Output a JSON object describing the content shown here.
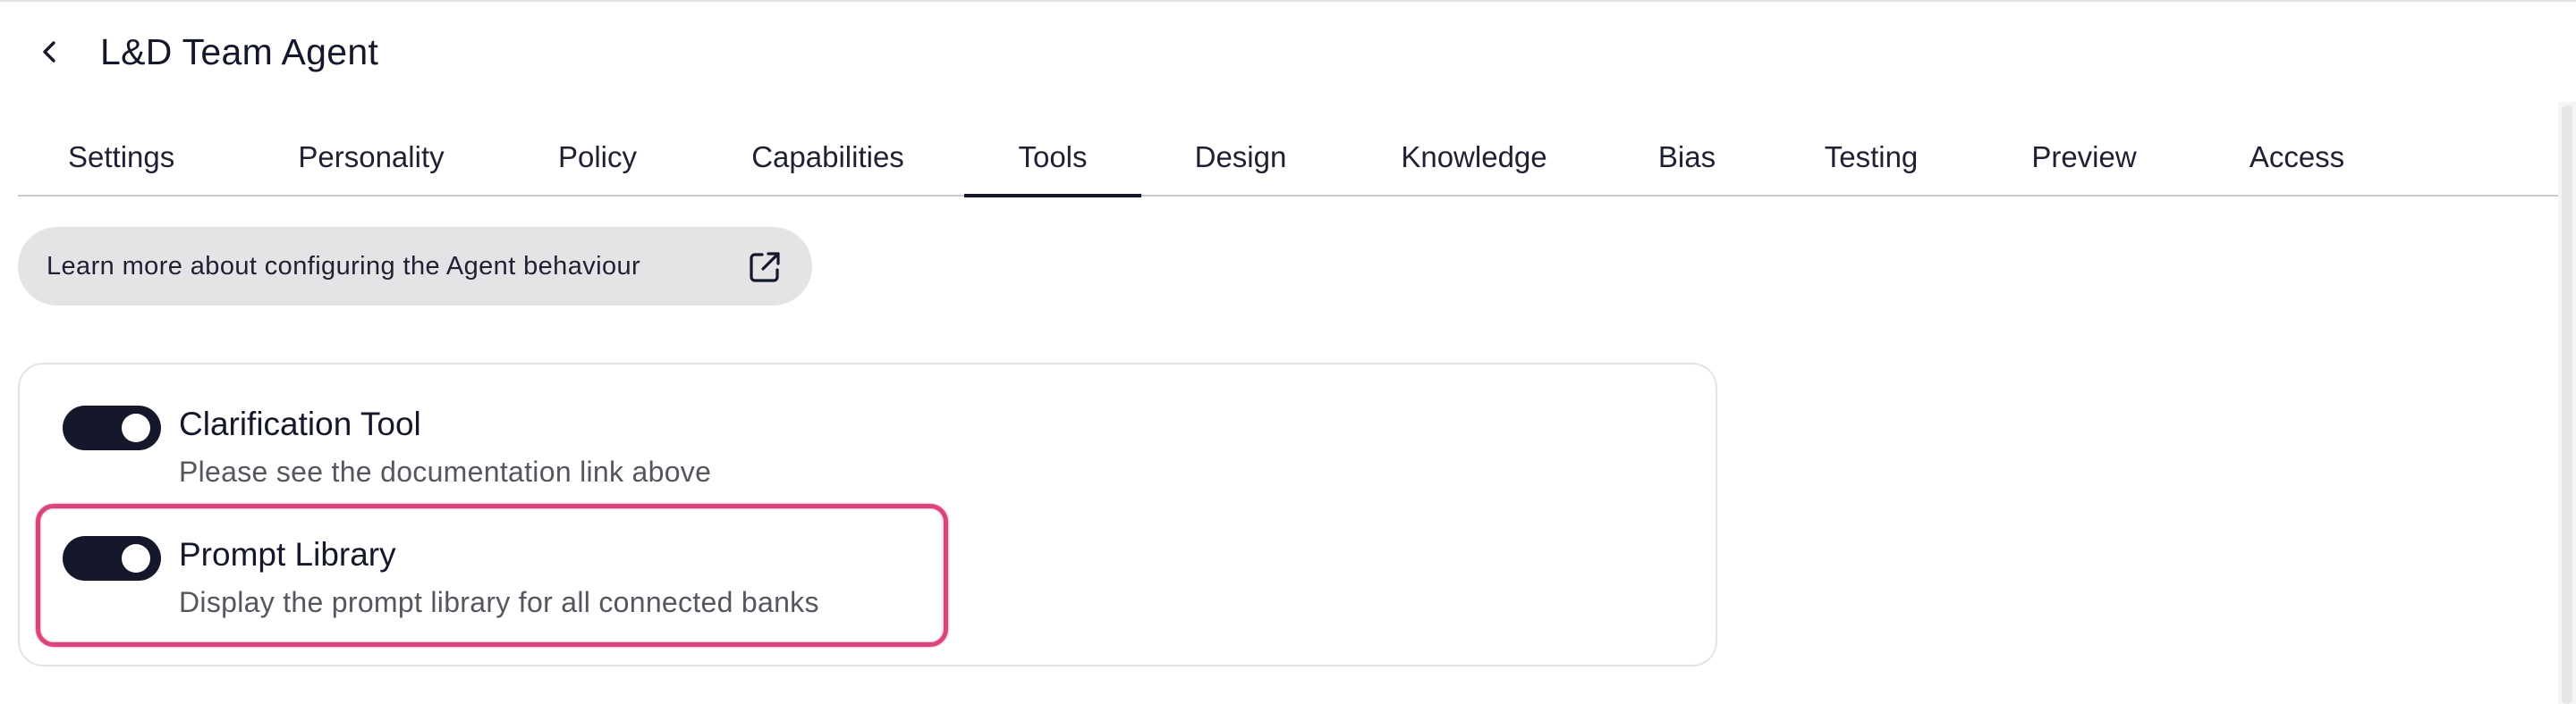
{
  "header": {
    "title": "L&D Team Agent",
    "back_icon": "chevron-left-icon"
  },
  "tabs": [
    {
      "label": "Settings",
      "active": false
    },
    {
      "label": "Personality",
      "active": false
    },
    {
      "label": "Policy",
      "active": false
    },
    {
      "label": "Capabilities",
      "active": false
    },
    {
      "label": "Tools",
      "active": true
    },
    {
      "label": "Design",
      "active": false
    },
    {
      "label": "Knowledge",
      "active": false
    },
    {
      "label": "Bias",
      "active": false
    },
    {
      "label": "Testing",
      "active": false
    },
    {
      "label": "Preview",
      "active": false
    },
    {
      "label": "Access",
      "active": false
    }
  ],
  "learn_more": {
    "label": "Learn more about configuring the Agent behaviour",
    "icon": "external-link-icon"
  },
  "tools": [
    {
      "title": "Clarification Tool",
      "description": "Please see the documentation link above",
      "enabled": true
    },
    {
      "title": "Prompt Library",
      "description": "Display the prompt library for all connected banks",
      "enabled": true
    }
  ],
  "colors": {
    "accent": "#15172a",
    "highlight": "#d9447d",
    "pill_bg": "#e4e4e6"
  }
}
